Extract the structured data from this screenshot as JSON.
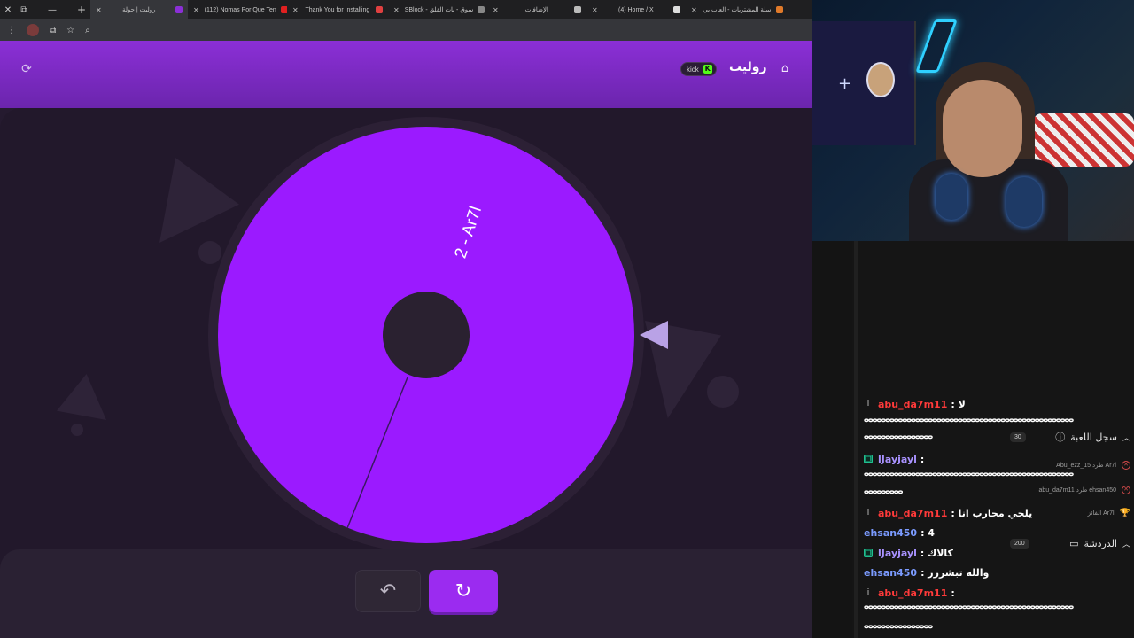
{
  "browser": {
    "tabs": [
      {
        "label": "روليت | جولة",
        "active": true,
        "favicon_color": "#8b2fd6"
      },
      {
        "label": "(112) Nomas Por Que Ten",
        "favicon_color": "#e02020"
      },
      {
        "label": "Thank You for Installing",
        "favicon_color": "#e04040"
      },
      {
        "label": "SBlock - سوق - بات القلق",
        "favicon_color": "#888888"
      },
      {
        "label": "الإضافات",
        "favicon_color": "#bbbbbb"
      },
      {
        "label": "(4) Home / X",
        "favicon_color": "#dddddd"
      },
      {
        "label": "سلة المشتريات - العاب بي",
        "favicon_color": "#e07a2a"
      }
    ],
    "new_tab": "+"
  },
  "roulette": {
    "title": "روليت",
    "kick_label": "kick",
    "kick_logo": "K",
    "wheel_label": "2 - Ar7l",
    "wheel_color": "#9b1aff",
    "undo_icon": "↶",
    "spin_icon": "↻"
  },
  "chat": {
    "lines": [
      {
        "user": "abu_da7m11",
        "color": "red",
        "text": ": لا",
        "badge": "ⅰ"
      },
      {
        "user": "lJayjayl",
        "color": "purple",
        "text": ":",
        "badge": "▣"
      },
      {
        "user": "abu_da7m11",
        "color": "red",
        "text": ": يلخي محارب انا",
        "badge": "ⅰ"
      },
      {
        "user": "ehsan450",
        "color": "blue",
        "text": ": 4",
        "badge": ""
      },
      {
        "user": "lJayjayl",
        "color": "purple",
        "text": ": كالاك",
        "badge": "▣"
      },
      {
        "user": "ehsan450",
        "color": "blue",
        "text": ": والله تبشررر",
        "badge": ""
      },
      {
        "user": "abu_da7m11",
        "color": "red",
        "text": ":",
        "badge": "ⅰ"
      }
    ],
    "spam_a": "ⴰⴰⴰⴰⴰⴰⴰⴰⴰⴰⴰⴰⴰⴰⴰⴰⴰⴰⴰⴰⴰⴰⴰⴰⴰⴰⴰⴰⴰⴰⴰⴰⴰⴰⴰⴰⴰⴰⴰⴰⴰⴰⴰⴰⴰⴰⴰⴰⴰ",
    "spam_b": "ⴰⴰⴰⴰⴰⴰⴰⴰⴰⴰⴰⴰⴰⴰⴰⴰ",
    "game_log": {
      "title": "سجل اللعبة",
      "count": "30",
      "rows": [
        {
          "text": "Abu_ezz_15 طرد Ar7l",
          "icon": "x"
        },
        {
          "text": "abu_da7m11 طرد ehsan450",
          "icon": "x"
        },
        {
          "text": "الفائز Ar7l",
          "icon": "trophy"
        }
      ]
    },
    "chat_tab": {
      "title": "الدردشة",
      "count": "200"
    }
  },
  "colors": {
    "accent": "#9b2bf0",
    "header": "#8b2fd6"
  }
}
